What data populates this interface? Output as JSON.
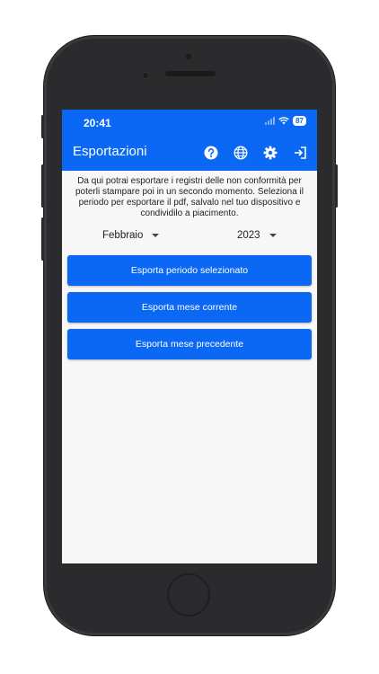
{
  "status_bar": {
    "time": "20:41",
    "battery": "87"
  },
  "app_bar": {
    "title": "Esportazioni",
    "icons": [
      "help-icon",
      "globe-icon",
      "gear-icon",
      "logout-icon"
    ]
  },
  "description": "Da qui potrai esportare i registri delle non conformità per poterli stampare poi in un secondo momento. Seleziona il periodo per esportare il pdf, salvalo nel tuo dispositivo e condividilo a piacimento.",
  "selectors": {
    "month": "Febbraio",
    "year": "2023"
  },
  "buttons": {
    "export_selected": "Esporta periodo selezionato",
    "export_current": "Esporta mese corrente",
    "export_previous": "Esporta mese precedente"
  },
  "colors": {
    "primary": "#0a68f5",
    "background": "#f7f7f8"
  }
}
